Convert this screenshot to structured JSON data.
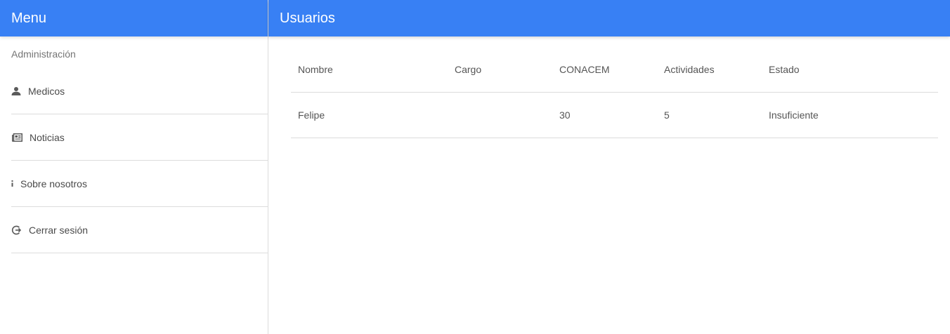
{
  "sidebar": {
    "title": "Menu",
    "section_title": "Administración",
    "items": [
      {
        "label": "Medicos",
        "icon": "person-icon"
      },
      {
        "label": "Noticias",
        "icon": "newspaper-icon"
      },
      {
        "label": "Sobre nosotros",
        "icon": "info-icon"
      },
      {
        "label": "Cerrar sesión",
        "icon": "logout-icon"
      }
    ]
  },
  "main": {
    "title": "Usuarios",
    "table": {
      "headers": [
        "Nombre",
        "Cargo",
        "CONACEM",
        "Actividades",
        "Estado"
      ],
      "rows": [
        [
          "Felipe",
          "",
          "30",
          "5",
          "Insuficiente"
        ]
      ]
    }
  },
  "colors": {
    "header_bg": "#3880f4",
    "header_text": "#ffffff",
    "divider": "#dcdcdc"
  }
}
